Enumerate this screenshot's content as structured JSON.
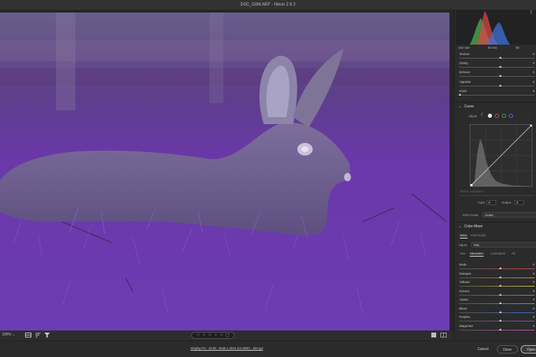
{
  "window": {
    "title": "DSC_3286.NEF  -  Nikon Z 6 2"
  },
  "toolbar": {
    "zoom_label": "100%",
    "zoom_caret": "⌄"
  },
  "status": {
    "info": "Display P3 - 16 bit - 6048 x 4024 (24.3MP) - 300 ppi"
  },
  "actions": {
    "cancel": "Cancel",
    "done": "Done",
    "open": "Open"
  },
  "camera_meta": {
    "iso": "ISO 100",
    "focal": "50 mm",
    "aperture": "f/8"
  },
  "detail_sliders": [
    {
      "label": "Texture",
      "value": 0
    },
    {
      "label": "Clarity",
      "value": 0
    },
    {
      "label": "Dehaze",
      "value": 0
    },
    {
      "label": "Vignette",
      "value": 0
    },
    {
      "label": "Grain",
      "value": 0
    }
  ],
  "curve": {
    "title": "Curve",
    "adjust_label": "Adjust",
    "channel_colors": [
      "#e6e6e6",
      "#d94a4a",
      "#3fae4d",
      "#3d7fd9"
    ],
    "refine_label": "Refine Saturation",
    "input_label": "Input",
    "input_value": "0",
    "output_label": "Output",
    "output_value": "0",
    "point_curve_label": "Point Curve",
    "point_curve_value": "Linear"
  },
  "color_mixer": {
    "title": "Color Mixer",
    "tabs": [
      "Mixer",
      "Point Color"
    ],
    "adjust_label": "Adjust",
    "adjust_value": "HSL",
    "subtabs": [
      "Hue",
      "Saturation",
      "Luminance",
      "All"
    ],
    "channels": [
      {
        "label": "Reds",
        "value": 0,
        "color": "#d94a4a"
      },
      {
        "label": "Oranges",
        "value": 0,
        "color": "#e08a3a"
      },
      {
        "label": "Yellows",
        "value": 0,
        "color": "#d8c73a"
      },
      {
        "label": "Greens",
        "value": 0,
        "color": "#4fb04a"
      },
      {
        "label": "Aquas",
        "value": 0,
        "color": "#3ab8b8"
      },
      {
        "label": "Blues",
        "value": 0,
        "color": "#3d6fd9"
      },
      {
        "label": "Purples",
        "value": 0,
        "color": "#8a4fd0"
      },
      {
        "label": "Magentas",
        "value": 0,
        "color": "#d04fb0"
      }
    ]
  },
  "stars": [
    "☆",
    "☆",
    "☆",
    "☆",
    "☆"
  ]
}
